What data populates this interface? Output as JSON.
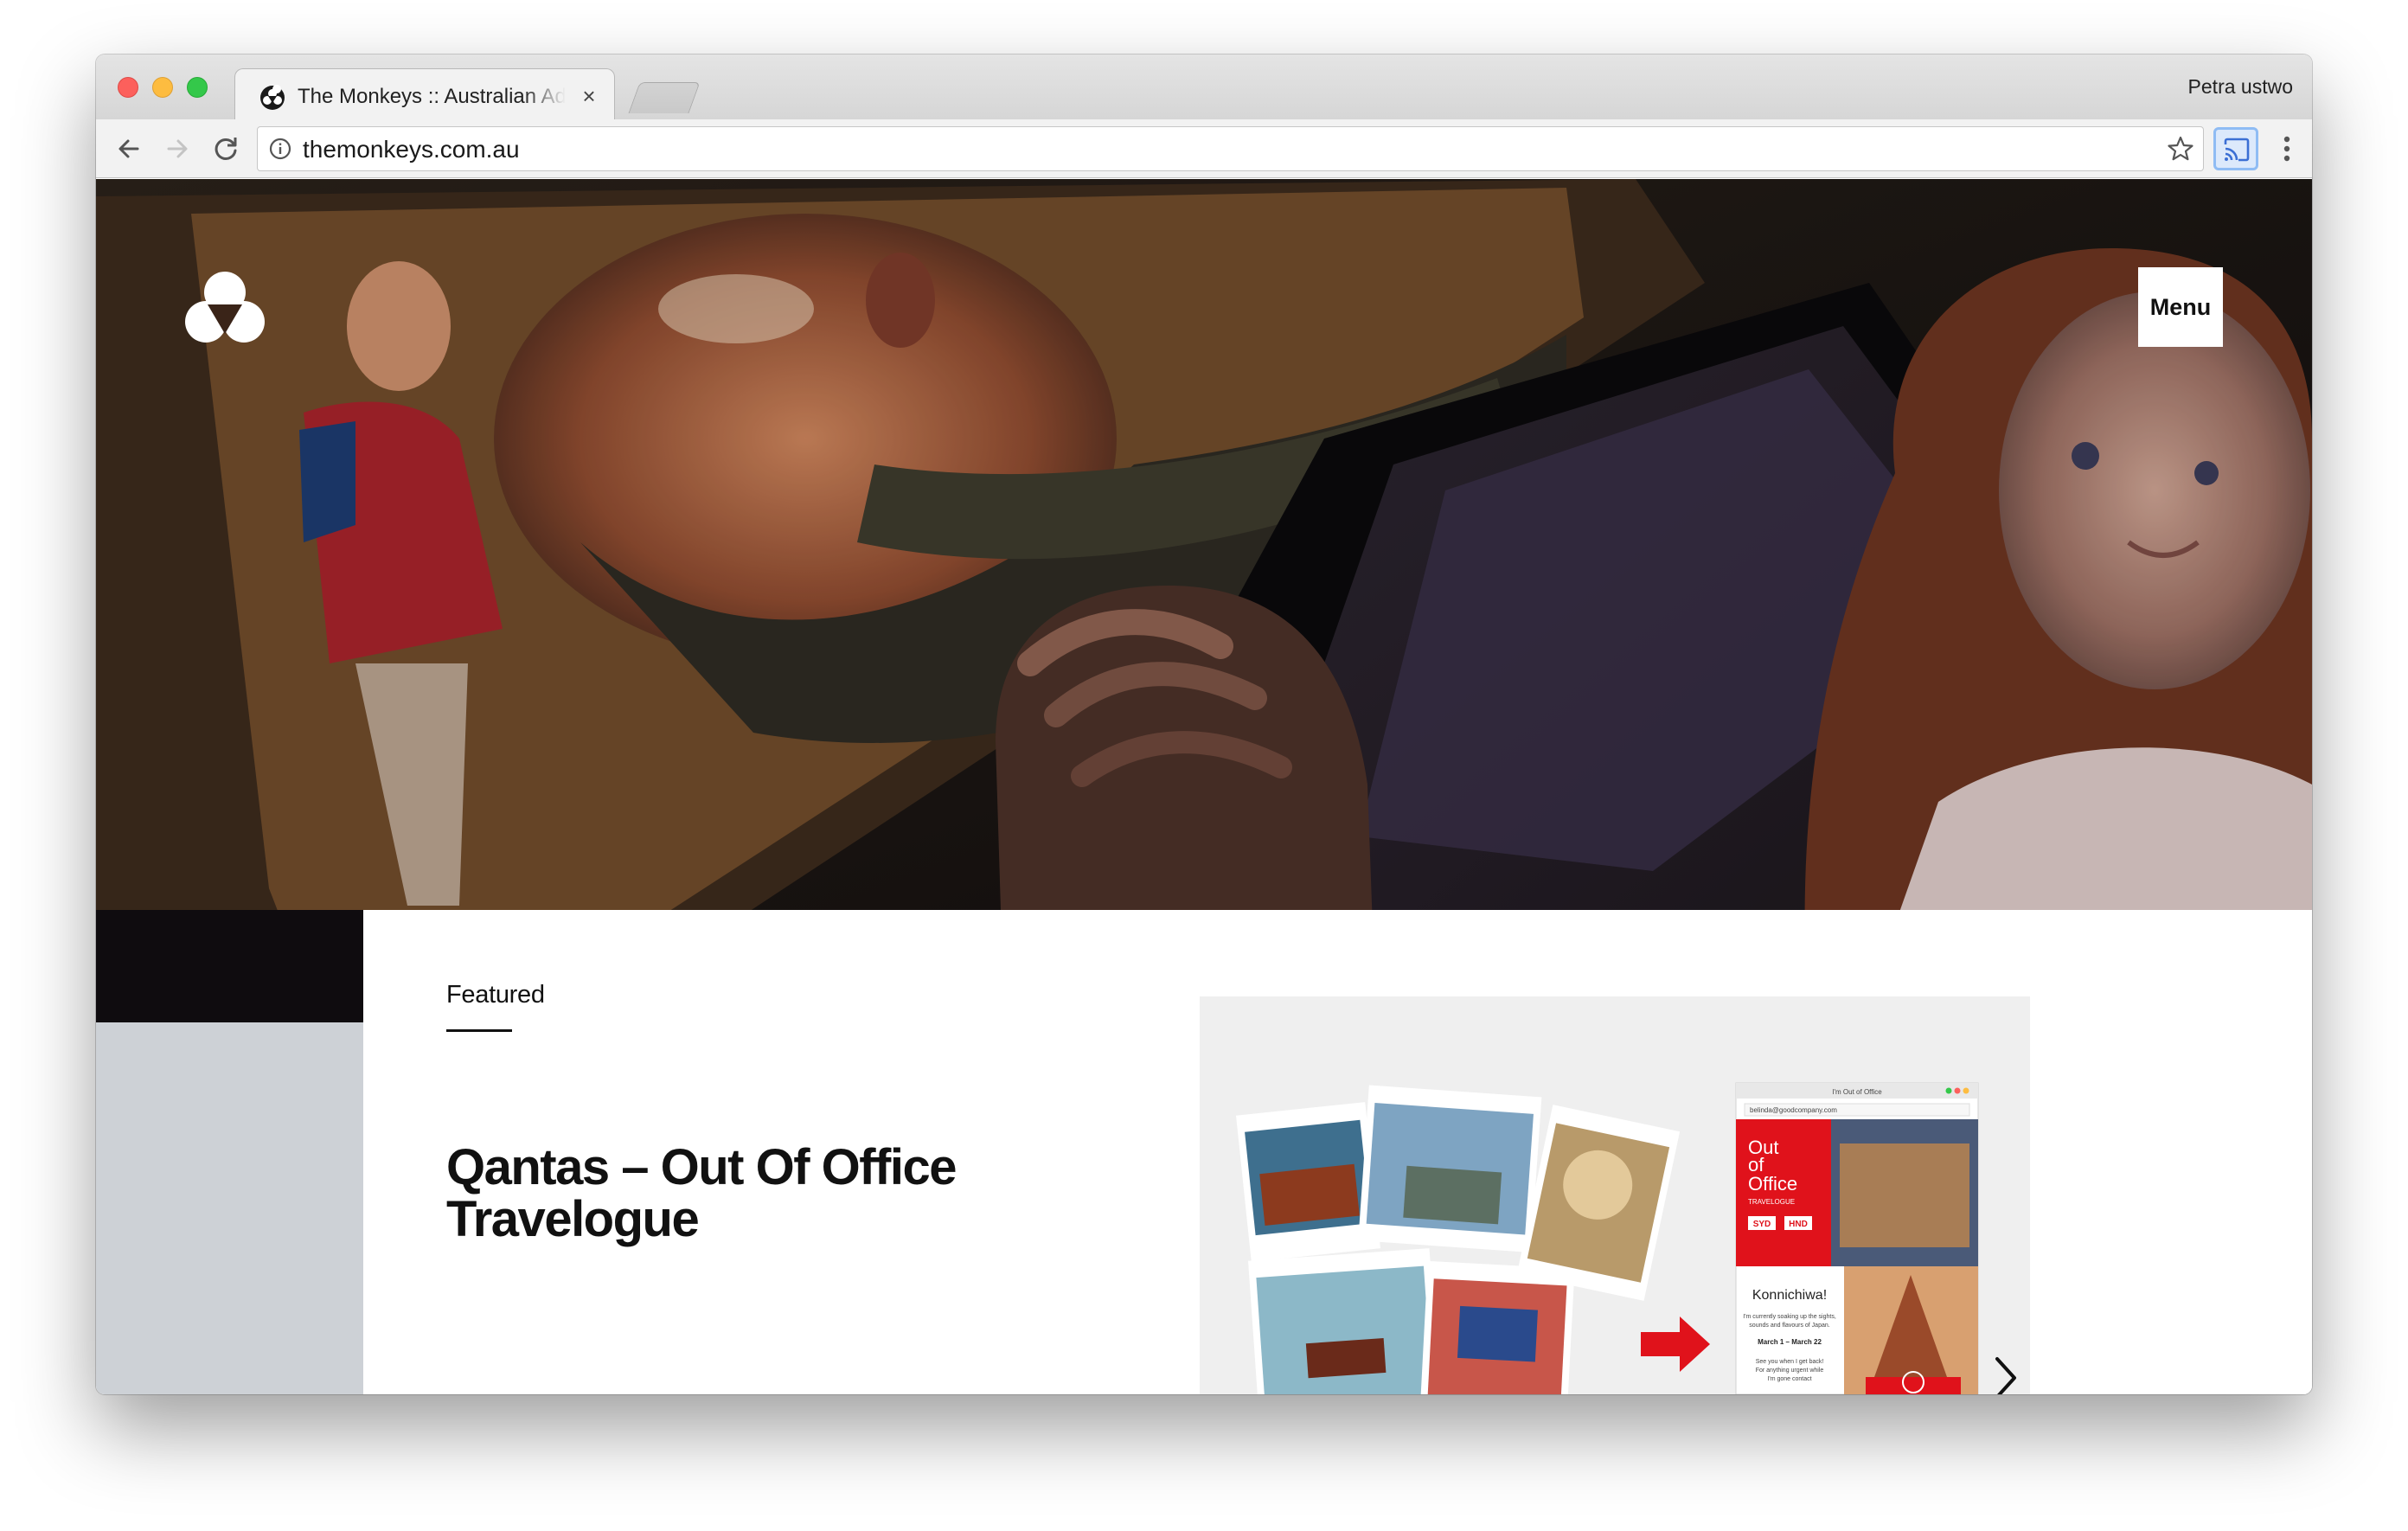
{
  "browser": {
    "tab_title": "The Monkeys :: Australian Ad Agency",
    "close_label": "×",
    "profile_name": "Petra ustwo",
    "url": "themonkeys.com.au"
  },
  "site": {
    "menu_label": "Menu",
    "featured_label": "Featured",
    "featured_title": "Qantas – Out Of Office Travelogue",
    "accent_color": "#e0121b",
    "left_panel_color": "#cdd1d6"
  },
  "feature_image": {
    "poster_title_line1": "Out",
    "poster_title_line2": "of",
    "poster_title_line3": "Office",
    "poster_sub": "TRAVELOGUE",
    "window_title": "I'm Out of Office",
    "email": "belinda@goodcompany.com",
    "greeting": "Konnichiwa!",
    "body_line1": "I'm currently soaking up the sights,",
    "body_line2": "sounds and flavours of Japan.",
    "dates": "March 1 – March 22",
    "sign_off_line1": "See you when I get back!",
    "sign_off_line2": "For anything urgent while",
    "sign_off_line3": "I'm gone contact",
    "flight_from": "SYD",
    "flight_to": "HND"
  },
  "icons": {
    "back": "arrow-left-icon",
    "forward": "arrow-right-icon",
    "reload": "reload-icon",
    "info": "info-icon",
    "bookmark": "star-icon",
    "cast": "cast-icon",
    "more": "kebab-icon",
    "next": "chevron-right-icon"
  }
}
